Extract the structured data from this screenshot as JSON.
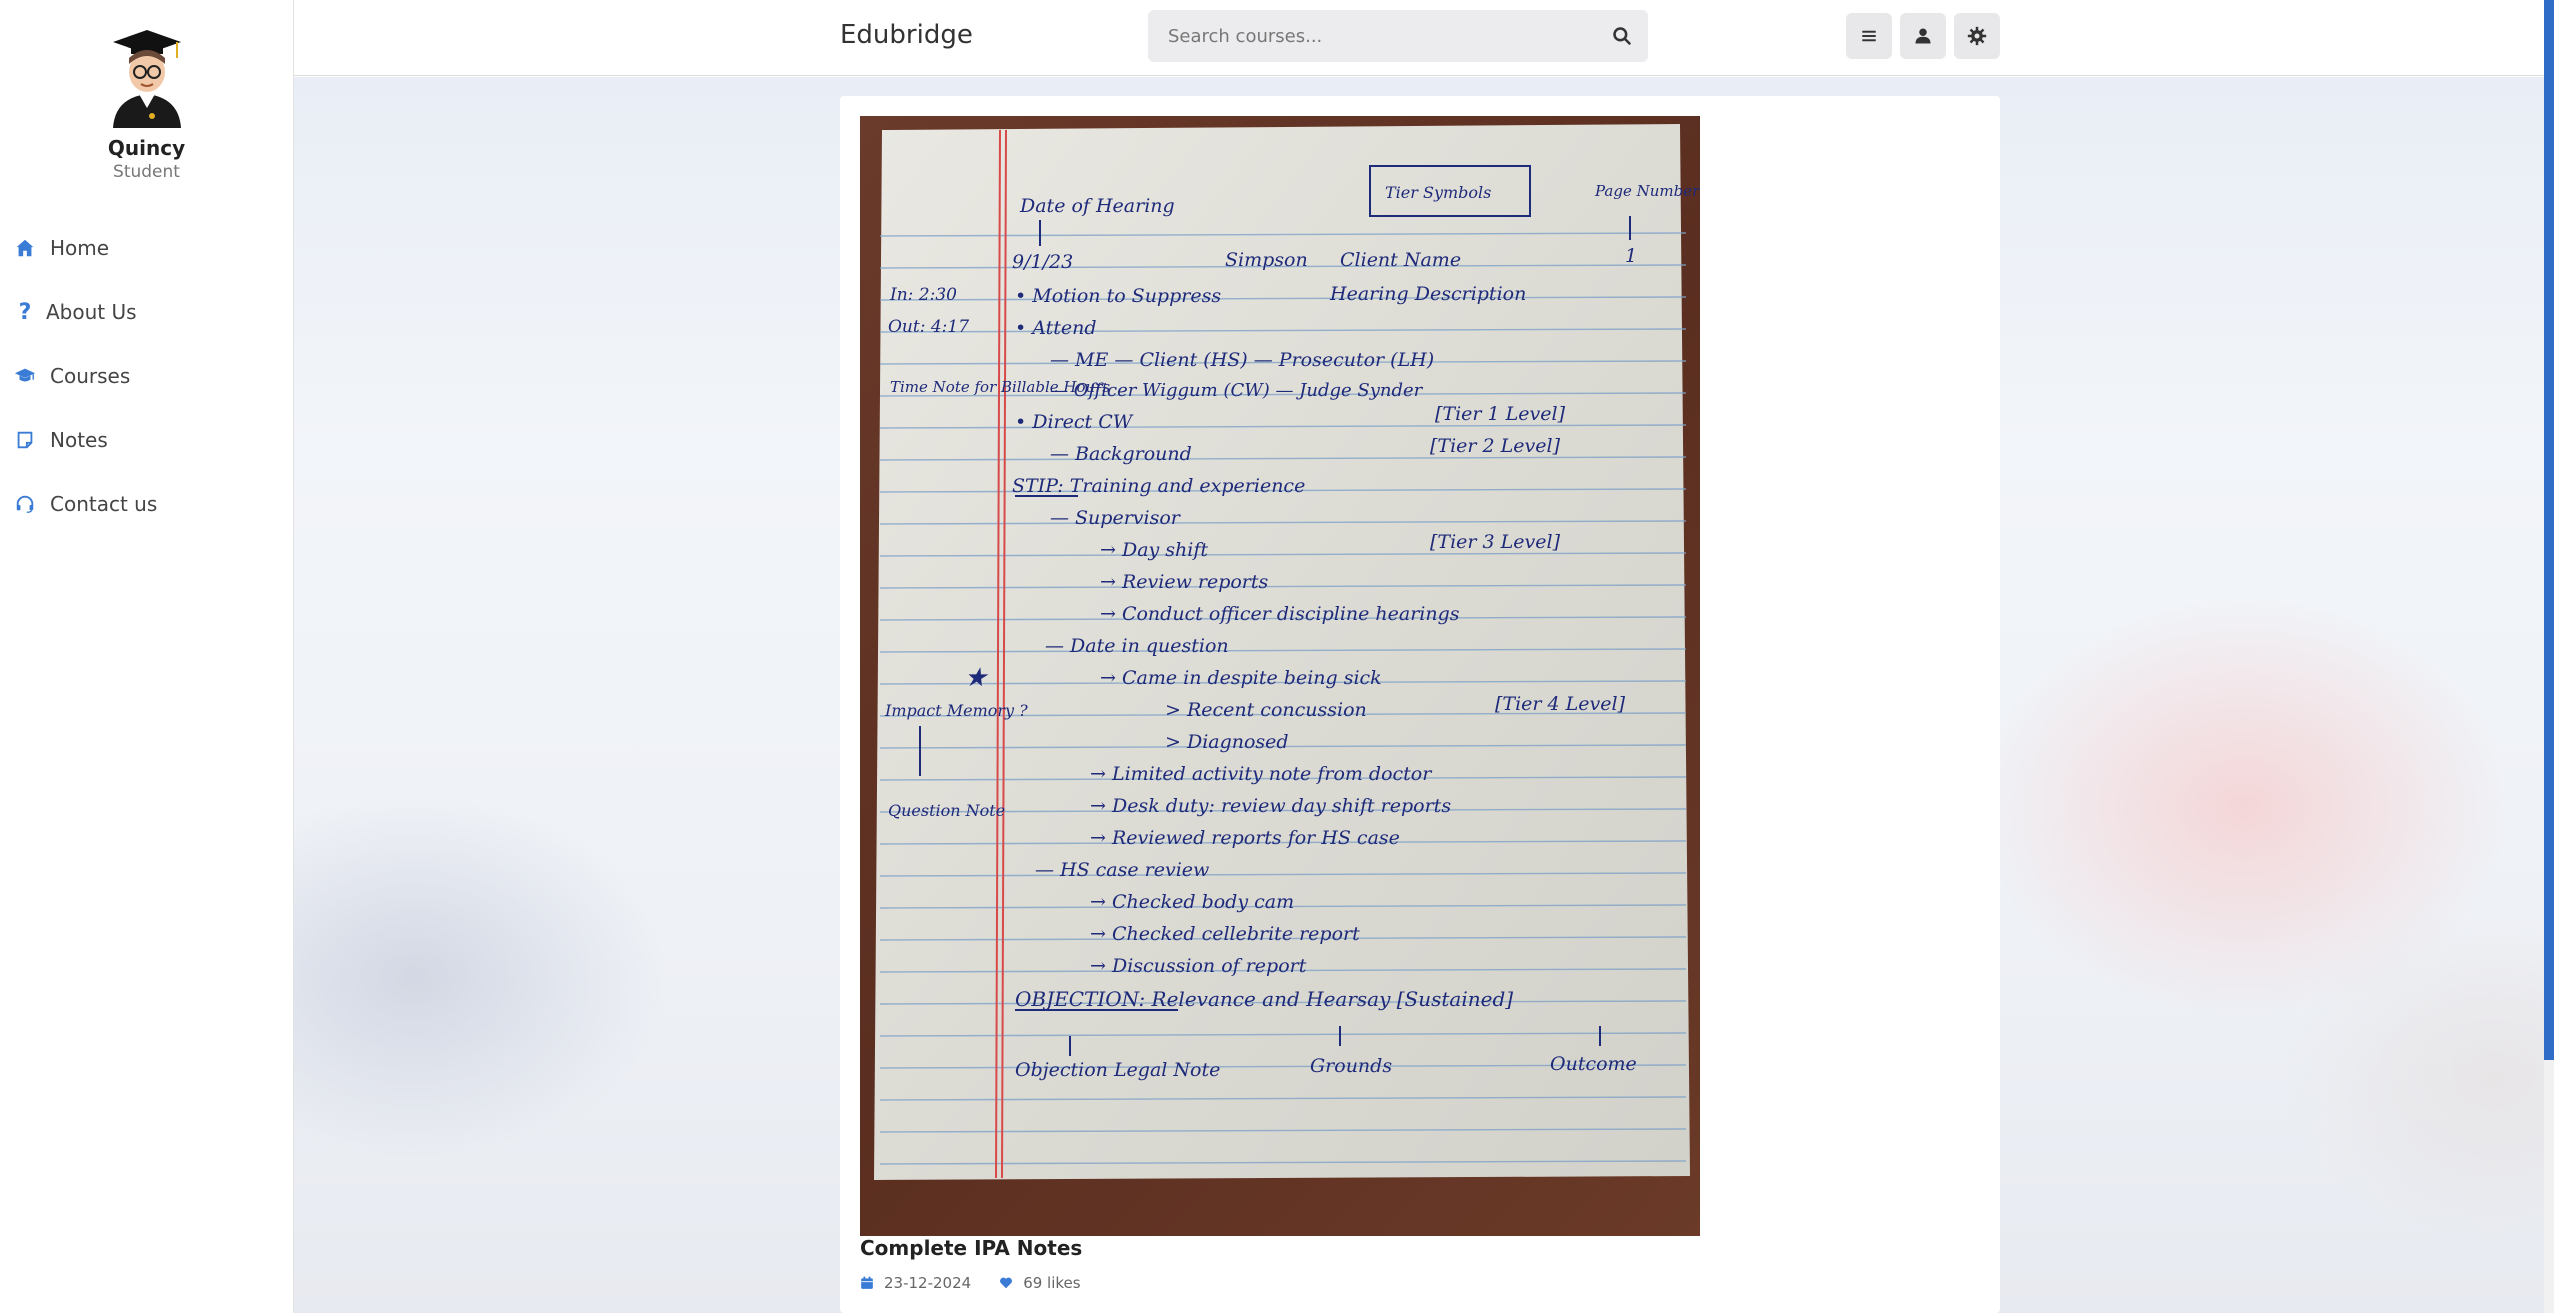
{
  "sidebar": {
    "profile": {
      "name": "Quincy",
      "role": "Student"
    },
    "items": [
      {
        "label": "Home",
        "icon": "home-icon"
      },
      {
        "label": "About Us",
        "icon": "question-icon"
      },
      {
        "label": "Courses",
        "icon": "graduation-cap-icon"
      },
      {
        "label": "Notes",
        "icon": "note-icon"
      },
      {
        "label": "Contact us",
        "icon": "headset-icon"
      }
    ]
  },
  "header": {
    "brand": "Edubridge",
    "search": {
      "placeholder": "Search courses...",
      "value": ""
    },
    "buttons": [
      "menu-icon",
      "user-icon",
      "settings-icon"
    ]
  },
  "note": {
    "image_text": {
      "date_label": "Date of Hearing",
      "tier_symbols": "Tier Symbols",
      "page_number_label": "Page Number",
      "date": "9/1/23",
      "client": "Simpson",
      "client_label": "Client Name",
      "page": "1",
      "time_in": "In: 2:30",
      "time_out": "Out: 4:17",
      "time_note": "Time Note for Billable Hours",
      "line1": "• Motion to Suppress",
      "line1_note": "Hearing Description",
      "line2": "• Attend",
      "line3": "— ME — Client (HS) — Prosecutor (LH)",
      "line4": "— Officer Wiggum (CW) — Judge Synder",
      "line5": "• Direct CW",
      "tier1": "[Tier 1 Level]",
      "line6": "— Background",
      "tier2": "[Tier 2 Level]",
      "line7": "STIP: Training and experience",
      "line8": "— Supervisor",
      "line9": "→ Day shift",
      "tier3": "[Tier 3 Level]",
      "line10": "→ Review reports",
      "line11": "→ Conduct officer discipline hearings",
      "line12": "— Date in question",
      "line13": "→ Came in despite being sick",
      "line14": "> Recent concussion",
      "tier4": "[Tier 4 Level]",
      "line15": "> Diagnosed",
      "impact": "Impact Memory ?",
      "question_note": "Question Note",
      "line16": "→ Limited activity note from doctor",
      "line17": "→ Desk duty: review day shift reports",
      "line18": "→ Reviewed reports for HS case",
      "line19": "— HS case review",
      "line20": "→ Checked body cam",
      "line21": "→ Checked cellebrite report",
      "line22": "→ Discussion of report",
      "objection": "OBJECTION: Relevance and Hearsay [Sustained]",
      "legal_note": "Objection Legal Note",
      "grounds": "Grounds",
      "outcome": "Outcome"
    },
    "title": "Complete IPA Notes",
    "date": "23-12-2024",
    "likes": "69 likes"
  },
  "colors": {
    "accent": "#3a7bd5",
    "ink": "#1e2a7a",
    "scrollbar": "#2f6cc8"
  }
}
